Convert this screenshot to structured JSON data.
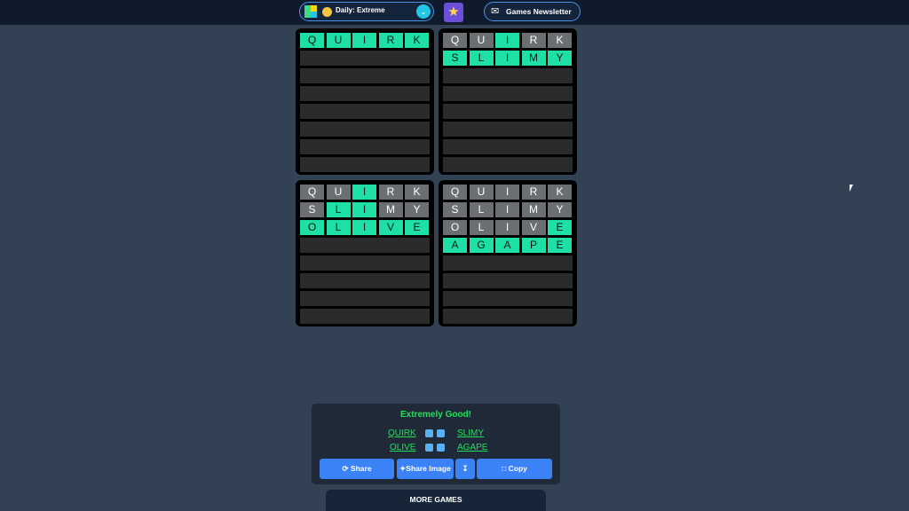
{
  "header": {
    "daily_label": "Daily: Extreme",
    "newsletter_label": "Games Newsletter",
    "icons": [
      "quordle-logo-icon",
      "emoji-face-icon",
      "chevron-down-icon",
      "star-icon",
      "newsletter-icon"
    ],
    "colors": {
      "bar": "#0f1b2d",
      "pill_border": "#4c90e8",
      "star": "#6b4fd8",
      "chevron": "#22c7e8"
    }
  },
  "boards": [
    {
      "rows": [
        {
          "letters": [
            "Q",
            "U",
            "I",
            "R",
            "K"
          ],
          "states": [
            "green",
            "green",
            "green",
            "green",
            "green"
          ]
        }
      ]
    },
    {
      "rows": [
        {
          "letters": [
            "Q",
            "U",
            "I",
            "R",
            "K"
          ],
          "states": [
            "gray",
            "gray",
            "green",
            "gray",
            "gray"
          ]
        },
        {
          "letters": [
            "S",
            "L",
            "I",
            "M",
            "Y"
          ],
          "states": [
            "green",
            "green",
            "green",
            "green",
            "green"
          ]
        }
      ]
    },
    {
      "rows": [
        {
          "letters": [
            "Q",
            "U",
            "I",
            "R",
            "K"
          ],
          "states": [
            "gray",
            "gray",
            "green",
            "gray",
            "gray"
          ]
        },
        {
          "letters": [
            "S",
            "L",
            "I",
            "M",
            "Y"
          ],
          "states": [
            "gray",
            "green",
            "green",
            "gray",
            "gray"
          ]
        },
        {
          "letters": [
            "O",
            "L",
            "I",
            "V",
            "E"
          ],
          "states": [
            "green",
            "green",
            "green",
            "green",
            "green"
          ]
        }
      ]
    },
    {
      "rows": [
        {
          "letters": [
            "Q",
            "U",
            "I",
            "R",
            "K"
          ],
          "states": [
            "gray",
            "gray",
            "gray",
            "gray",
            "gray"
          ]
        },
        {
          "letters": [
            "S",
            "L",
            "I",
            "M",
            "Y"
          ],
          "states": [
            "gray",
            "gray",
            "gray",
            "gray",
            "gray"
          ]
        },
        {
          "letters": [
            "O",
            "L",
            "I",
            "V",
            "E"
          ],
          "states": [
            "gray",
            "gray",
            "gray",
            "gray",
            "green"
          ]
        },
        {
          "letters": [
            "A",
            "G",
            "A",
            "P",
            "E"
          ],
          "states": [
            "green",
            "green",
            "green",
            "green",
            "green"
          ]
        }
      ]
    }
  ],
  "tile_colors": {
    "green": "#1ee0a6",
    "gray": "#6b6e72",
    "empty": "#2a2b2d"
  },
  "result": {
    "title": "Extremely Good!",
    "words": [
      "QUIRK",
      "SLIMY",
      "OLIVE",
      "AGAPE"
    ],
    "share_label": "Share",
    "share_image_label": "Share Image",
    "copy_label": "Copy"
  },
  "more_games": {
    "label": "MORE GAMES"
  }
}
